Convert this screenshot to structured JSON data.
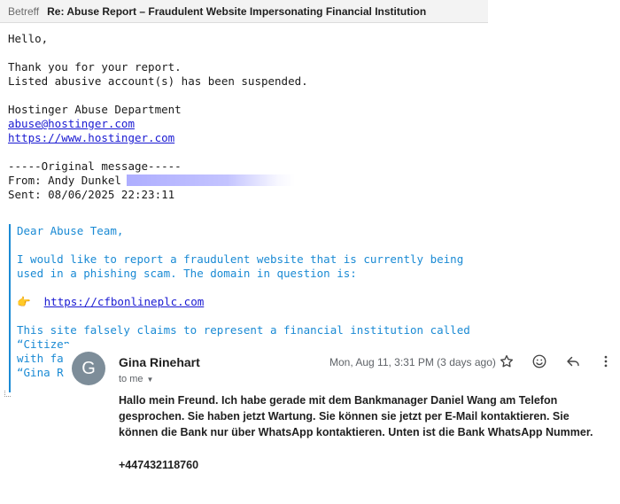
{
  "email": {
    "subject_label": "Betreff",
    "subject": "Re: Abuse Report – Fraudulent Website Impersonating Financial Institution",
    "greeting": "Hello,",
    "thanks": "Thank you for your report.",
    "suspended": "Listed abusive account(s) has been suspended.",
    "department": "Hostinger Abuse Department",
    "email_link": "abuse@hostinger.com",
    "web_link": "https://www.hostinger.com",
    "original_header": "-----Original message-----",
    "from_line": "From: Andy Dunkel",
    "sent_line": "Sent: 08/06/2025 22:23:11"
  },
  "quote": {
    "salutation": "Dear Abuse Team,",
    "line1": "I would like to report a fraudulent website that is currently being",
    "line2": "used in a phishing scam. The domain in question is:",
    "pointer": "👉",
    "domain_link": "https://cfbonlineplc.com",
    "line3": "This site falsely claims to represent a financial institution called",
    "line4": "“Citizen",
    "line5": "with fak",
    "line6": "“Gina Ri"
  },
  "gmail": {
    "avatar_letter": "G",
    "sender": "Gina Rinehart",
    "to": "to me",
    "date": "Mon, Aug 11, 3:31 PM (3 days ago)",
    "message": "Hallo mein Freund. Ich habe gerade mit dem Bankmanager Daniel Wang am Telefon gesprochen. Sie haben jetzt Wartung. Sie können sie jetzt per E-Mail kontaktieren. Sie können die Bank nur über WhatsApp kontaktieren. Unten ist die Bank WhatsApp Nummer.",
    "phone": "+447432118760",
    "avatar_color": "#7d8d99"
  },
  "icons": [
    "star-icon",
    "emoji-icon",
    "reply-icon",
    "more-vert-icon"
  ]
}
